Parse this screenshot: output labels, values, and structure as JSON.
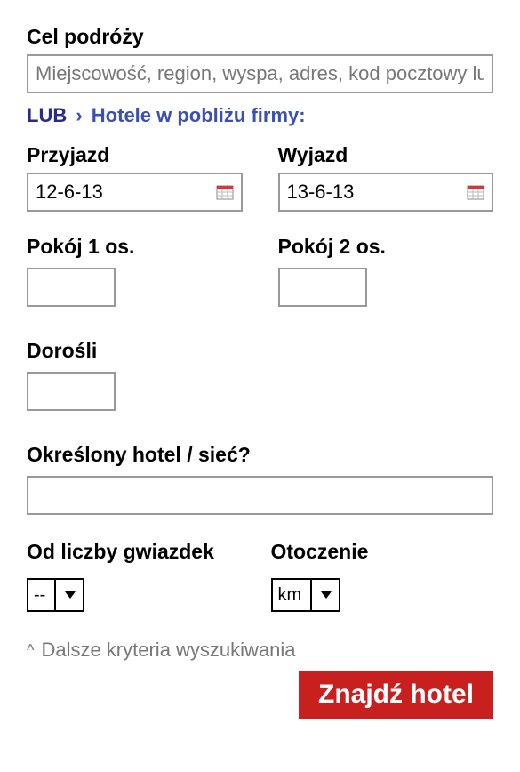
{
  "destination": {
    "label": "Cel podróży",
    "placeholder": "Miejscowość, region, wyspa, adres, kod pocztowy lub nazwa hotelu"
  },
  "orLine": {
    "or": "LUB",
    "chevron": "›",
    "linkText": "Hotele w pobliżu firmy:"
  },
  "arrival": {
    "label": "Przyjazd",
    "value": "12-6-13"
  },
  "departure": {
    "label": "Wyjazd",
    "value": "13-6-13"
  },
  "room1": {
    "label": "Pokój 1 os."
  },
  "room2": {
    "label": "Pokój 2 os."
  },
  "adults": {
    "label": "Dorośli"
  },
  "specificHotel": {
    "label": "Określony hotel / sieć?"
  },
  "stars": {
    "label": "Od liczby gwiazdek",
    "value": "--"
  },
  "surroundings": {
    "label": "Otoczenie",
    "value": "km"
  },
  "moreCriteria": {
    "caret": "^",
    "label": "Dalsze kryteria wyszukiwania"
  },
  "submit": {
    "label": "Znajdź hotel"
  }
}
